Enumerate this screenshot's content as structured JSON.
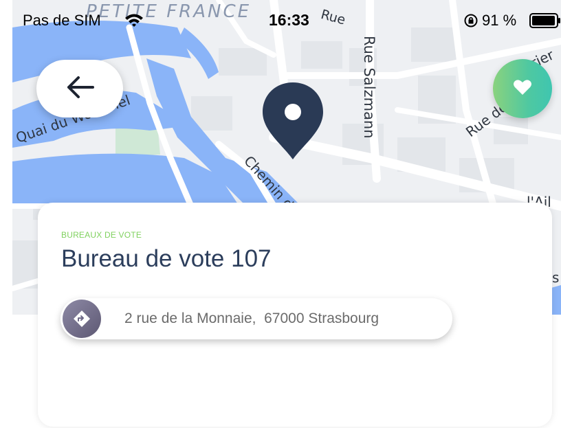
{
  "status_bar": {
    "carrier": "Pas de SIM",
    "time": "16:33",
    "battery": "91 %",
    "icons": [
      "wifi-icon",
      "orientation-lock-icon",
      "battery-icon"
    ]
  },
  "map": {
    "labels": {
      "district": "PETITE FRANCE",
      "quai": "Quai du Woerthel",
      "chemin": "Chemin d",
      "salzmann": "Rue Salzmann",
      "rue_top": "Rue",
      "rue_right": "Rue de",
      "frag_top_right": "rier",
      "frag_mid_right": "l'Ail",
      "frag_edge": "s"
    },
    "colors": {
      "water": "#8ab4f8",
      "park": "#cfe8d6",
      "land": "#eef0f3",
      "road": "#ffffff"
    }
  },
  "buttons": {
    "back_icon": "arrow-left-icon",
    "favorite_icon": "heart-icon"
  },
  "marker": {
    "icon": "location-pin-icon",
    "color": "#2a3a55"
  },
  "card": {
    "category": "BUREAUX DE VOTE",
    "title": "Bureau de vote 107",
    "address": "2 rue de la Monnaie,  67000 Strasbourg",
    "address_icon": "directions-icon"
  },
  "colors": {
    "accent_green": "#7fd15e",
    "title_navy": "#2c3e5c",
    "favorite_gradient_start": "#8ad27e",
    "favorite_gradient_end": "#3fc6b0"
  }
}
